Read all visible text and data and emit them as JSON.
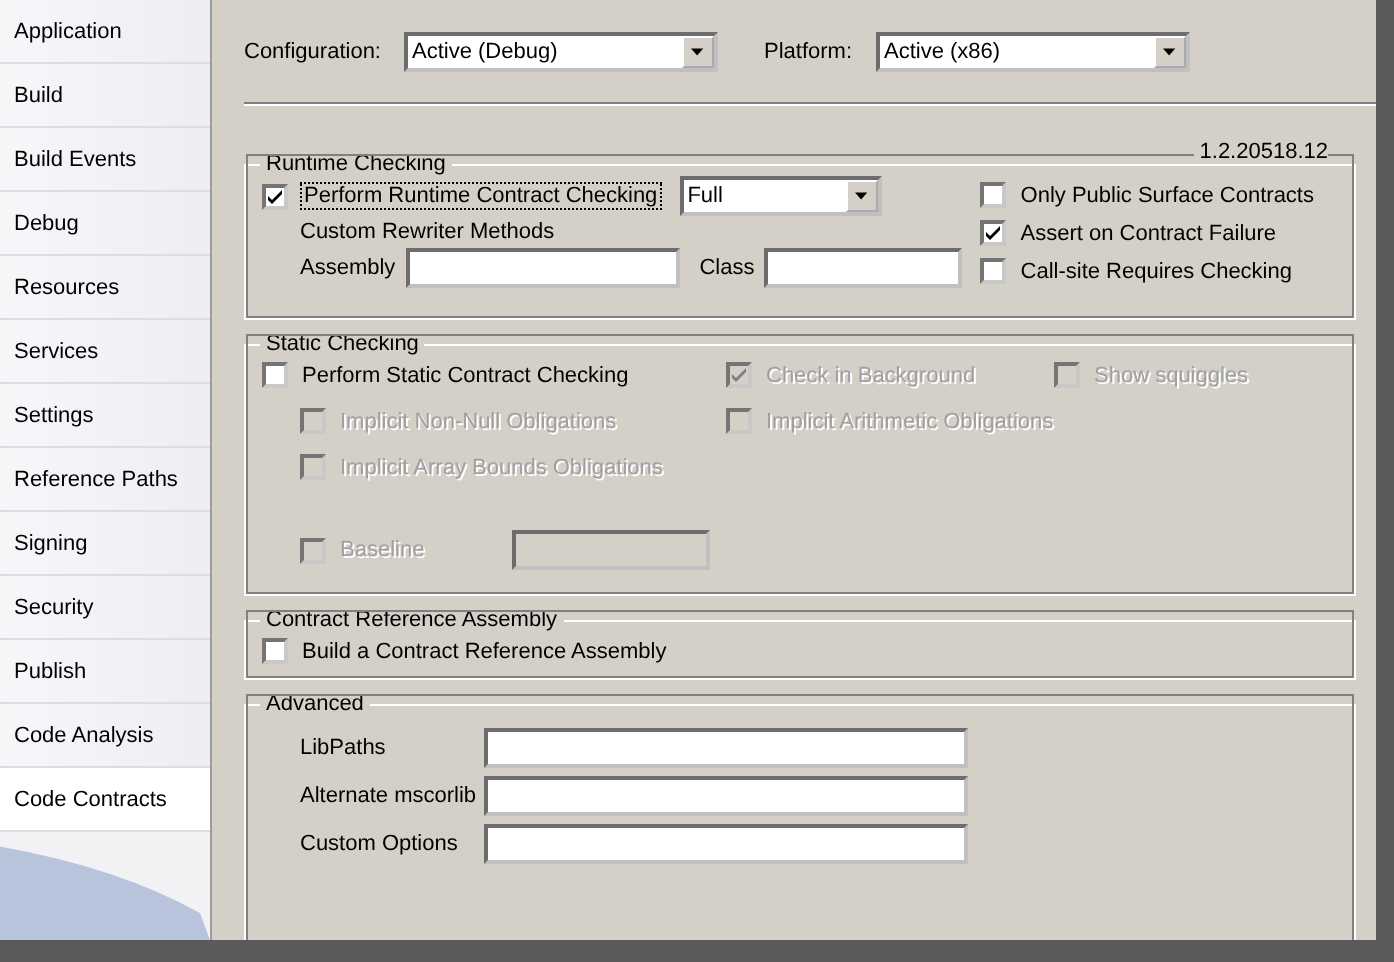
{
  "sidebar": {
    "items": [
      {
        "label": "Application",
        "selected": false
      },
      {
        "label": "Build",
        "selected": false
      },
      {
        "label": "Build Events",
        "selected": false
      },
      {
        "label": "Debug",
        "selected": false
      },
      {
        "label": "Resources",
        "selected": false
      },
      {
        "label": "Services",
        "selected": false
      },
      {
        "label": "Settings",
        "selected": false
      },
      {
        "label": "Reference Paths",
        "selected": false
      },
      {
        "label": "Signing",
        "selected": false
      },
      {
        "label": "Security",
        "selected": false
      },
      {
        "label": "Publish",
        "selected": false
      },
      {
        "label": "Code Analysis",
        "selected": false
      },
      {
        "label": "Code Contracts",
        "selected": true
      }
    ]
  },
  "configuration": {
    "label": "Configuration:",
    "value": "Active (Debug)"
  },
  "platform": {
    "label": "Platform:",
    "value": "Active (x86)"
  },
  "version": "1.2.20518.12",
  "runtime_checking": {
    "title": "Runtime Checking",
    "perform": {
      "label": "Perform Runtime Contract Checking",
      "checked": true
    },
    "level": "Full",
    "custom_rewriter_label": "Custom Rewriter Methods",
    "assembly_label": "Assembly",
    "class_label": "Class",
    "options": [
      {
        "label": "Only Public Surface Contracts",
        "checked": false
      },
      {
        "label": "Assert on Contract Failure",
        "checked": true
      },
      {
        "label": "Call-site Requires Checking",
        "checked": false
      }
    ]
  },
  "static_checking": {
    "title": "Static Checking",
    "perform": {
      "label": "Perform Static Contract Checking",
      "checked": false,
      "disabled": false
    },
    "options": [
      {
        "label": "Check in Background",
        "checked": true,
        "disabled": true
      },
      {
        "label": "Show squiggles",
        "checked": false,
        "disabled": true
      }
    ],
    "obligations": [
      {
        "label": "Implicit Non-Null Obligations",
        "checked": false,
        "disabled": true
      },
      {
        "label": "Implicit Arithmetic Obligations",
        "checked": false,
        "disabled": true
      },
      {
        "label": "Implicit Array Bounds Obligations",
        "checked": false,
        "disabled": true
      }
    ],
    "baseline": {
      "label": "Baseline",
      "checked": false,
      "disabled": true
    }
  },
  "contract_reference": {
    "title": "Contract Reference Assembly",
    "build": {
      "label": "Build a Contract Reference Assembly",
      "checked": false,
      "disabled": false
    }
  },
  "advanced": {
    "title": "Advanced",
    "fields": [
      {
        "label": "LibPaths"
      },
      {
        "label": "Alternate mscorlib"
      },
      {
        "label": "Custom Options"
      }
    ]
  }
}
